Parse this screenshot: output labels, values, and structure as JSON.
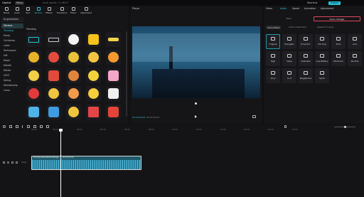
{
  "app": {
    "name": "CapCut",
    "menu": "Menu",
    "project": "Auto saved: 11:48:07",
    "shortcut": "Shortcut",
    "export": "Export"
  },
  "toolbar": [
    {
      "label": "Media"
    },
    {
      "label": "Audio"
    },
    {
      "label": "Text"
    },
    {
      "label": "Stickers"
    },
    {
      "label": "Effects"
    },
    {
      "label": "Transitions"
    },
    {
      "label": "Filters"
    },
    {
      "label": "Adjustment"
    }
  ],
  "sidebar": {
    "ai": "AI generated",
    "items": [
      "Stickers",
      "Trending",
      "Emoji",
      "Christmas",
      "cyber",
      "Techniques",
      "Gift",
      "Mood",
      "Details",
      "Winter",
      "2023",
      "Spring",
      "Membership",
      "Lama"
    ]
  },
  "section_label": "Trending",
  "player": {
    "title": "Player",
    "time_current": "00:00:00:09",
    "time_total": "00:00:04:22"
  },
  "props": {
    "tabs": [
      "Video",
      "Audio",
      "Speed",
      "Animation",
      "Adjustment"
    ],
    "sub_tabs": [
      "Basic",
      "Voice changer"
    ],
    "segment": [
      "Voice filters",
      "Voice characters",
      "Speech to song"
    ],
    "filters": [
      "Original",
      "Energetic",
      "Eccentric",
      "Mic Hog",
      "Echo",
      "Lore",
      "High",
      "Deep",
      "Distorted",
      "Low Battery",
      "Electronic",
      "Rumble",
      "Vinyl",
      "Lo-fi",
      "Megaphone",
      "Synth"
    ]
  },
  "timeline": {
    "ticks": [
      "00:00",
      "00:10",
      "00:20",
      "00:30",
      "00:40",
      "00:50",
      "01:00",
      "01:10",
      "01:20",
      "01:30",
      "01:40",
      "01:50"
    ],
    "clip_label": "The fog-shrouded buildings",
    "clip_time": "00:00:04:22",
    "cover": "Cover"
  }
}
